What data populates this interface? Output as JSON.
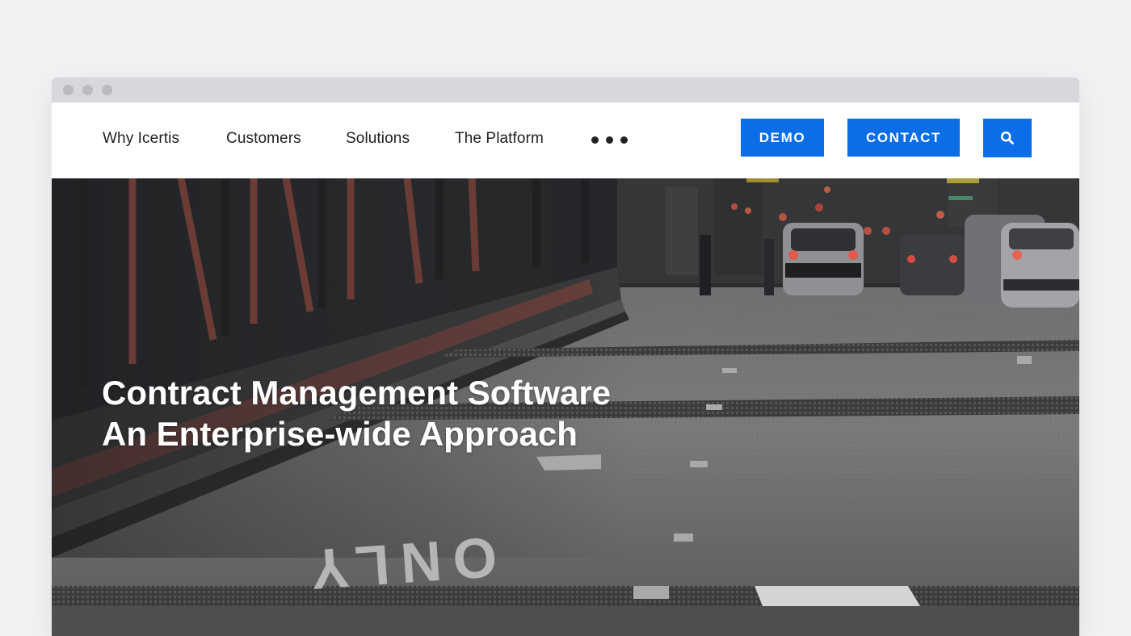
{
  "nav": {
    "links": [
      "Why Icertis",
      "Customers",
      "Solutions",
      "The Platform"
    ],
    "more_icon": "more-horizontal-icon",
    "demo_label": "DEMO",
    "contact_label": "CONTACT",
    "search_icon": "search-icon"
  },
  "hero": {
    "title_line1": "Contract Management Software",
    "title_line2": "An Enterprise-wide Approach",
    "road_marking": "ONLY"
  },
  "colors": {
    "accent": "#0b6ee6",
    "page_background": "#f1f2f4",
    "titlebar": "#d6d8dd"
  }
}
